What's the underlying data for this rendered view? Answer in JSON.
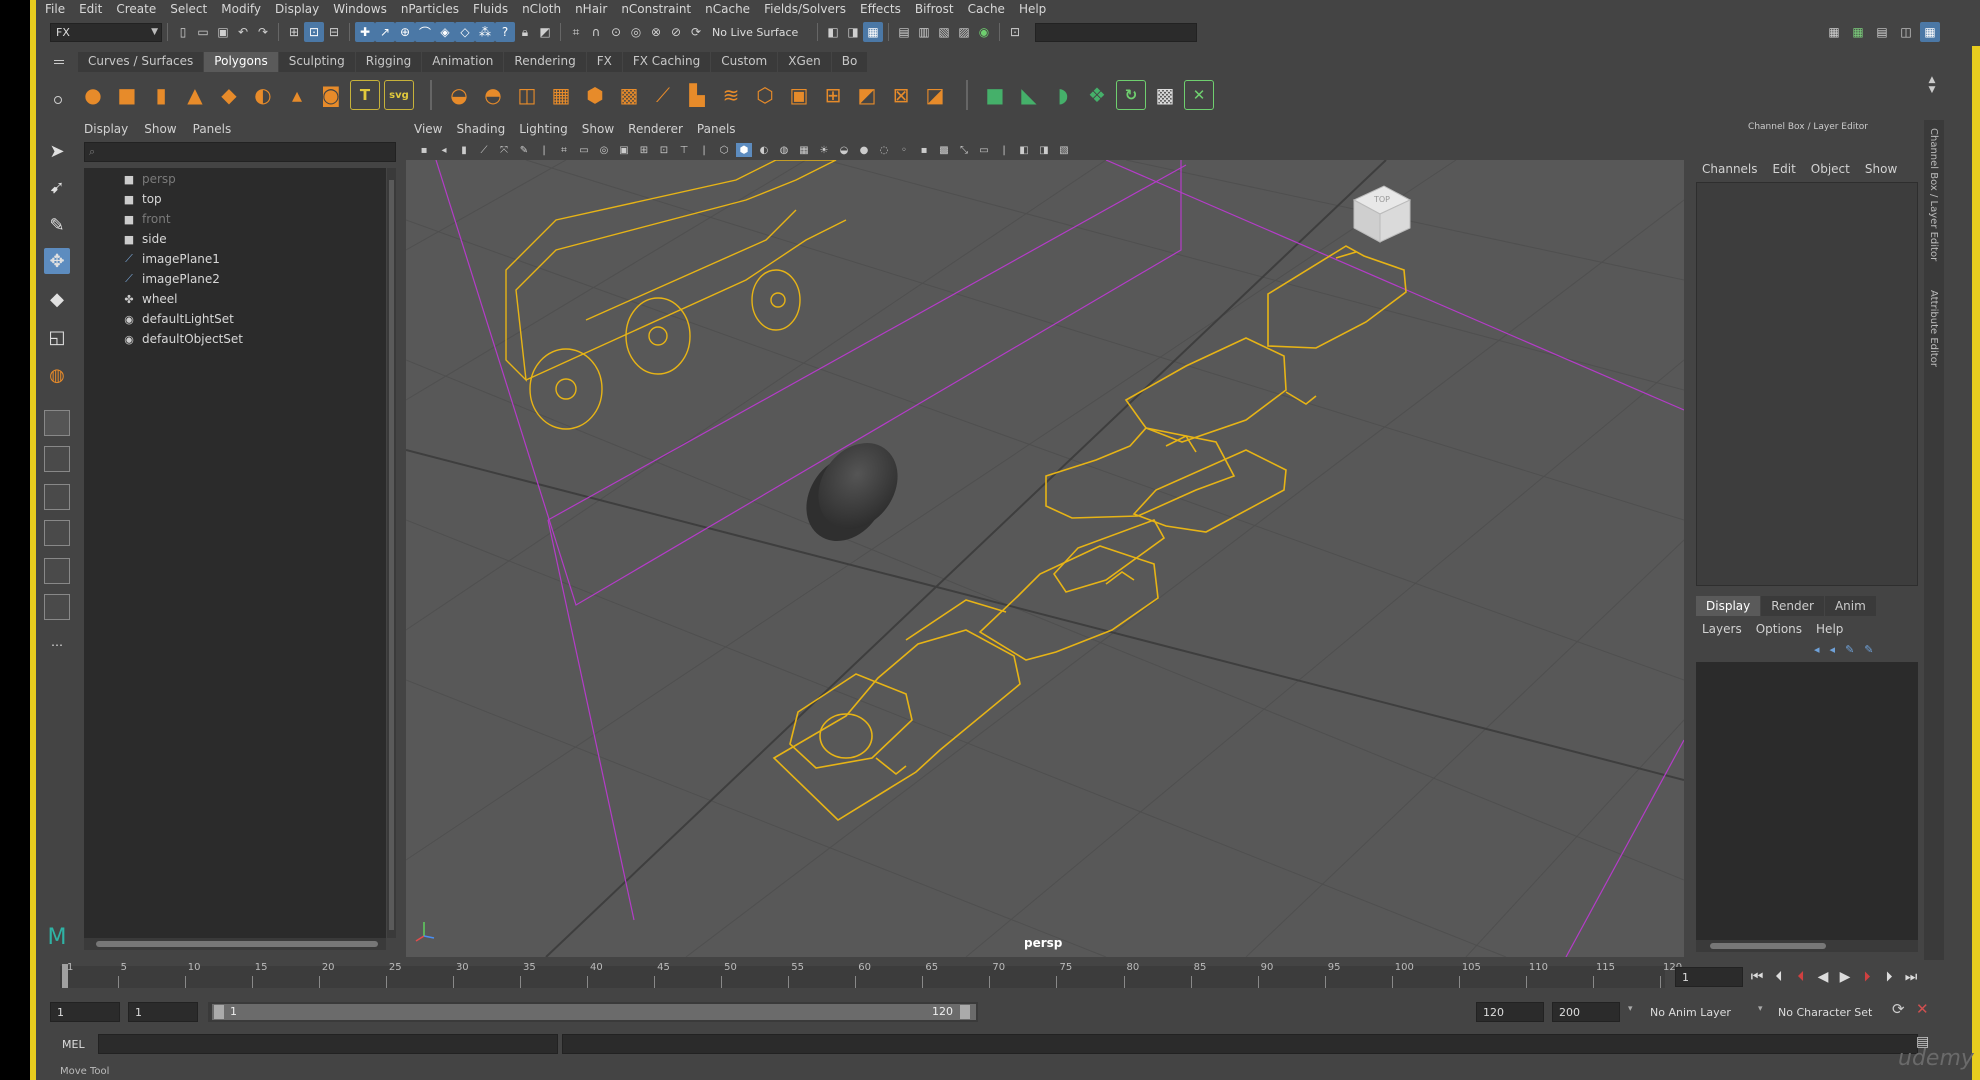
{
  "menubar": [
    "File",
    "Edit",
    "Create",
    "Select",
    "Modify",
    "Display",
    "Windows",
    "nParticles",
    "Fluids",
    "nCloth",
    "nHair",
    "nConstraint",
    "nCache",
    "Fields/Solvers",
    "Effects",
    "Bifrost",
    "Cache",
    "Help"
  ],
  "statusline": {
    "menuset": "FX",
    "live_surface": "No Live Surface"
  },
  "shelf": {
    "tabs": [
      "Curves / Surfaces",
      "Polygons",
      "Sculpting",
      "Rigging",
      "Animation",
      "Rendering",
      "FX",
      "FX Caching",
      "Custom",
      "XGen",
      "Bo"
    ],
    "active_tab": "Polygons"
  },
  "outliner": {
    "menu": [
      "Display",
      "Show",
      "Panels"
    ],
    "items": [
      {
        "label": "persp",
        "icon": "camera-icon",
        "dim": true
      },
      {
        "label": "top",
        "icon": "camera-icon",
        "dim": false
      },
      {
        "label": "front",
        "icon": "camera-icon",
        "dim": true
      },
      {
        "label": "side",
        "icon": "camera-icon",
        "dim": false
      },
      {
        "label": "imagePlane1",
        "icon": "image-plane-icon",
        "dim": false
      },
      {
        "label": "imagePlane2",
        "icon": "image-plane-icon",
        "dim": false
      },
      {
        "label": "wheel",
        "icon": "mesh-transform-icon",
        "dim": false
      },
      {
        "label": "defaultLightSet",
        "icon": "set-icon",
        "dim": false
      },
      {
        "label": "defaultObjectSet",
        "icon": "set-icon",
        "dim": false
      }
    ]
  },
  "viewport": {
    "menu": [
      "View",
      "Shading",
      "Lighting",
      "Show",
      "Renderer",
      "Panels"
    ],
    "camera_label": "persp",
    "viewcube_label": "TOP"
  },
  "channelbox": {
    "title": "Channel Box / Layer Editor",
    "menu": [
      "Channels",
      "Edit",
      "Object",
      "Show"
    ],
    "layer_tabs": [
      "Display",
      "Render",
      "Anim"
    ],
    "active_layer_tab": "Display",
    "layer_menu": [
      "Layers",
      "Options",
      "Help"
    ],
    "side_tabs": [
      "Channel Box / Layer Editor",
      "Attribute Editor"
    ]
  },
  "timeslider": {
    "labels": [
      "1",
      "5",
      "10",
      "15",
      "20",
      "25",
      "30",
      "35",
      "40",
      "45",
      "50",
      "55",
      "60",
      "65",
      "70",
      "75",
      "80",
      "85",
      "90",
      "95",
      "100",
      "105",
      "110",
      "115",
      "120"
    ],
    "current_frame": "1"
  },
  "range": {
    "start": "1",
    "playback_start": "1",
    "slider_start": "1",
    "slider_end": "120",
    "playback_end": "120",
    "end": "200",
    "anim_layer": "No Anim Layer",
    "character_set": "No Character Set"
  },
  "cmdline": {
    "label": "MEL"
  },
  "helpline": {
    "text": "Move Tool"
  },
  "watermark": "udemy",
  "colors": {
    "accent": "#5d8cbf",
    "wire": "#e7b416",
    "grid_edge": "#b43cc8",
    "border": "#e8cc1e"
  }
}
